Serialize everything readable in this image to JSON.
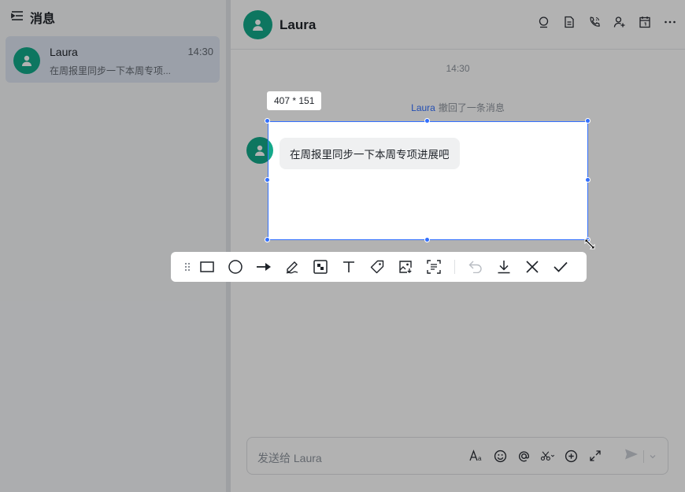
{
  "sidebar": {
    "title": "消息",
    "conversation": {
      "name": "Laura",
      "time": "14:30",
      "preview": "在周报里同步一下本周专项..."
    }
  },
  "chat": {
    "title": "Laura",
    "timestamp": "14:30",
    "recall_user": "Laura",
    "recall_text": "撤回了一条消息",
    "message": "在周报里同步一下本周专项进展吧",
    "input_placeholder": "发送给 Laura",
    "header_icons": [
      "search-icon",
      "doc-icon",
      "phone-icon",
      "add-member-icon",
      "calendar-icon",
      "more-icon"
    ],
    "input_tools": [
      "text-format-icon",
      "emoji-icon",
      "mention-icon",
      "scissors-icon",
      "add-icon",
      "expand-icon"
    ]
  },
  "screenshot_tool": {
    "size_label": "407 * 151",
    "tools": [
      "drag-handle",
      "rectangle",
      "ellipse",
      "arrow",
      "pen",
      "mosaic",
      "text",
      "tag",
      "pin-image",
      "ocr",
      "undo",
      "download",
      "cancel",
      "confirm"
    ]
  },
  "colors": {
    "accent": "#3370ff",
    "avatar": "#14a98a"
  }
}
